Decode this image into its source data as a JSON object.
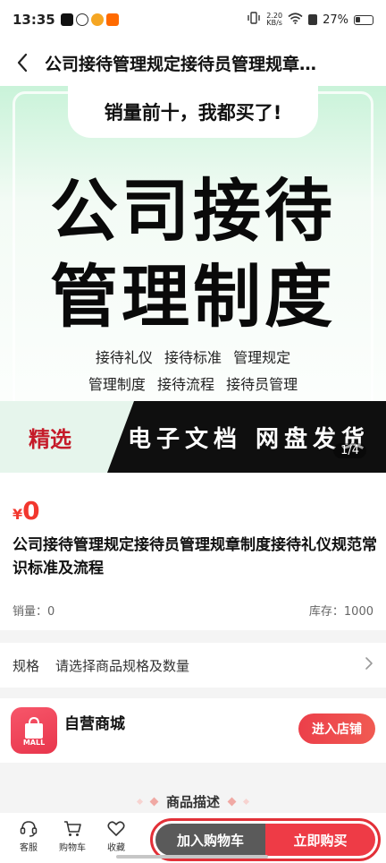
{
  "status_bar": {
    "time": "13:35",
    "net_speed": "2.20",
    "net_unit": "KB/s",
    "battery": "27%"
  },
  "nav": {
    "title": "公司接待管理规定接待员管理规章…"
  },
  "banner": {
    "tagline": "销量前十，我都买了!",
    "headline_line1": "公司接待",
    "headline_line2": "管理制度",
    "keywords_line1": "接待礼仪 接待标准 管理规定",
    "keywords_line2": "管理制度 接待流程 接待员管理",
    "pick_label": "精选",
    "band_text": "电子文档 网盘发货",
    "counter": "1/4"
  },
  "product": {
    "currency": "¥",
    "price": "0",
    "title": "公司接待管理规定接待员管理规章制度接待礼仪规范常识标准及流程",
    "sales": "销量：0",
    "stock": "库存：1000"
  },
  "spec": {
    "label": "规格",
    "value": "请选择商品规格及数量"
  },
  "shop": {
    "logo_text": "MALL",
    "name": "自营商城",
    "enter_label": "进入店铺"
  },
  "description": {
    "heading": "商品描述"
  },
  "bottom_bar": {
    "service_label": "客服",
    "cart_label": "购物车",
    "favorite_label": "收藏",
    "add_to_cart_label": "加入购物车",
    "buy_now_label": "立即购买"
  },
  "colors": {
    "accent": "#ee3b46",
    "dark_button": "#5a5a5a",
    "price": "#f2372e"
  }
}
